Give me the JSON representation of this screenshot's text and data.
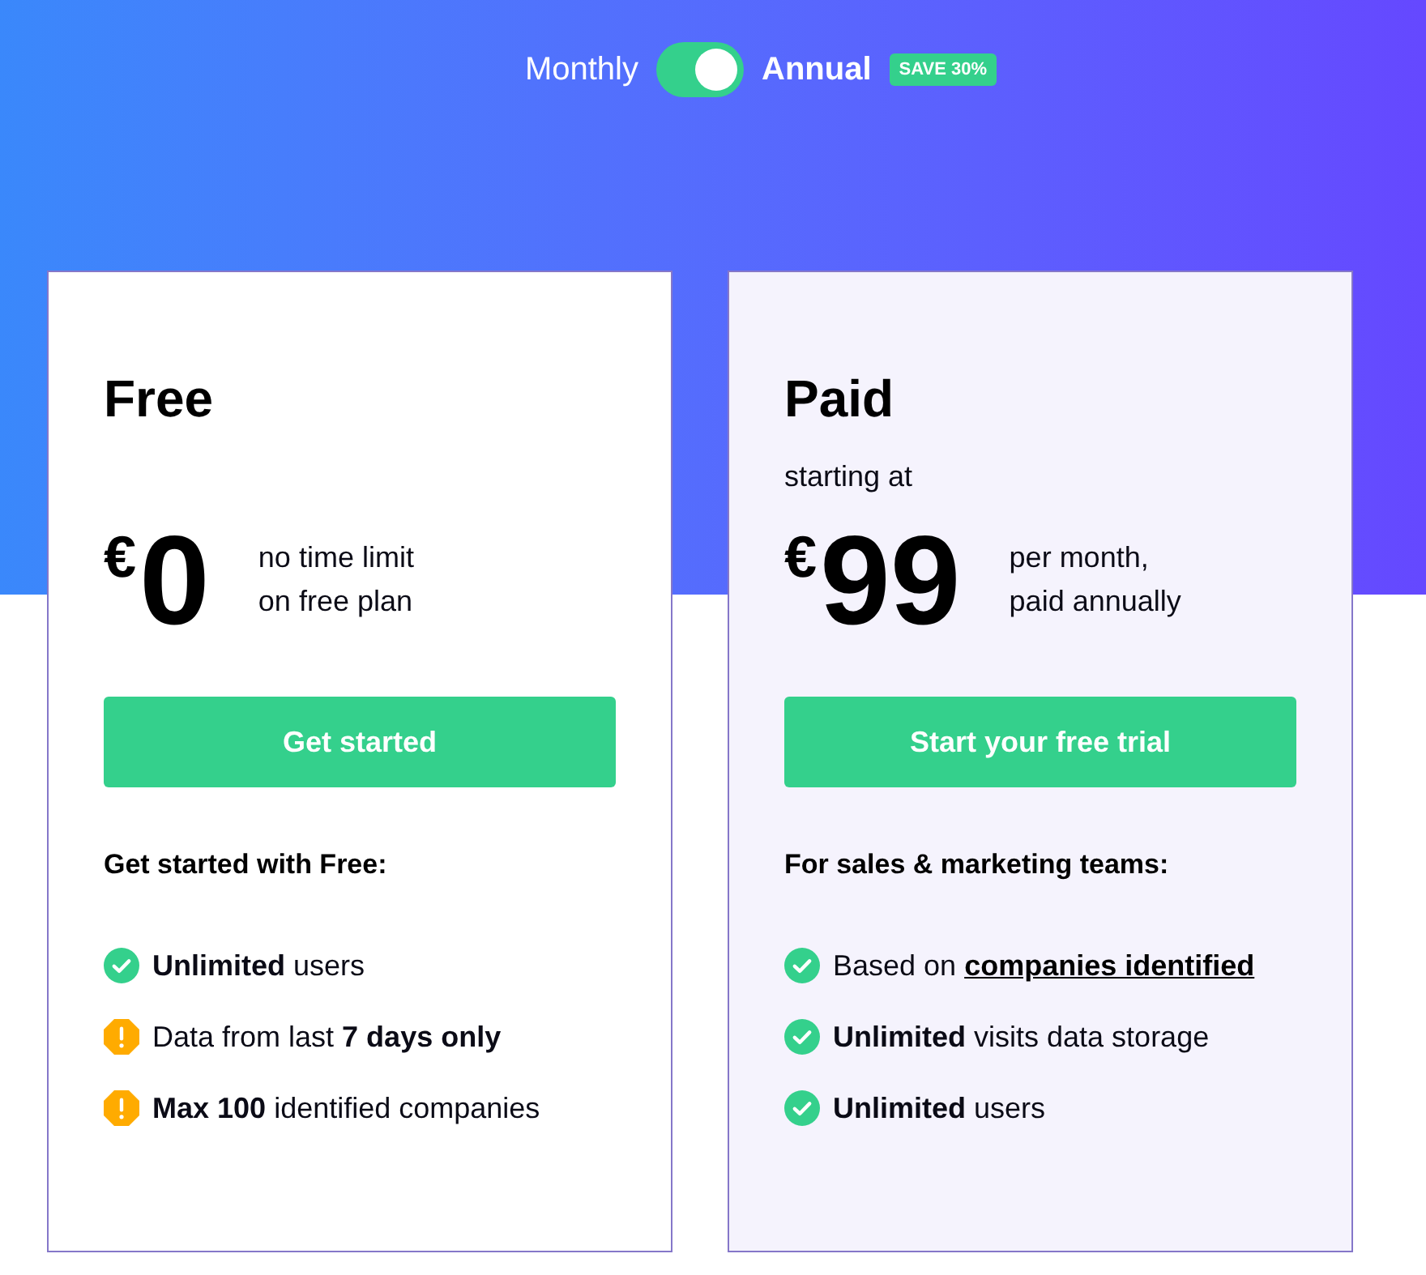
{
  "billing": {
    "options": [
      {
        "label": "Monthly",
        "selected": false
      },
      {
        "label": "Annual",
        "selected": true
      }
    ],
    "badge": "SAVE 30%"
  },
  "plans": [
    {
      "name": "Free",
      "featured": false,
      "price": {
        "currency": "€",
        "amount": "0",
        "note": "no time limit\non free plan"
      },
      "button": "Get started",
      "features_heading": "Get started with Free:",
      "features": [
        {
          "kind": "check",
          "text": "**Unlimited** users"
        },
        {
          "kind": "warning",
          "text": "Data from last **7 days only**"
        },
        {
          "kind": "warning",
          "text": "**Max 100** identified companies"
        }
      ]
    },
    {
      "name": "Paid",
      "featured": true,
      "subtitle": "starting at",
      "price": {
        "currency": "€",
        "amount": "99",
        "note": "per month,\npaid annually"
      },
      "button": "Start your free trial",
      "features_heading": "For sales & marketing teams:",
      "features": [
        {
          "kind": "check",
          "text": "Based on",
          "link": "companies identified"
        },
        {
          "kind": "check",
          "text": "**Unlimited** visits data storage"
        },
        {
          "kind": "check",
          "text": "**Unlimited** users"
        }
      ]
    }
  ]
}
